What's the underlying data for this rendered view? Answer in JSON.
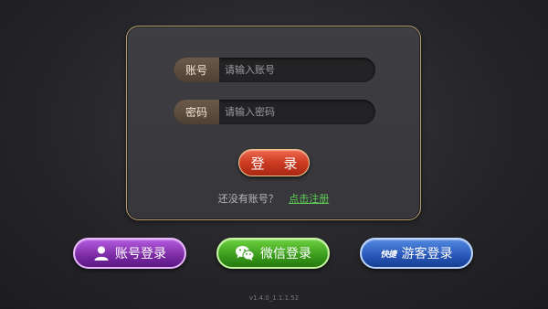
{
  "login_panel": {
    "account_field": {
      "label": "账号",
      "placeholder": "请输入账号",
      "value": ""
    },
    "password_field": {
      "label": "密码",
      "placeholder": "请输入密码",
      "value": ""
    },
    "login_button": "登 录",
    "register_prompt": "还没有账号？",
    "register_link": "点击注册"
  },
  "bottom_buttons": {
    "account_login": {
      "label": "账号登录",
      "icon": "user-icon",
      "color": "#7a2aa3"
    },
    "wechat_login": {
      "label": "微信登录",
      "icon": "wechat-icon",
      "color": "#3a9a1c"
    },
    "guest_login": {
      "label": "游客登录",
      "icon": "quick-icon",
      "icon_text": "快捷",
      "color": "#2856b8"
    }
  },
  "version": "v1.4.0_1.1.1.52",
  "colors": {
    "panel_border": "#b59a6e",
    "accent_link": "#5fcc56",
    "login_red": "#cc3b22"
  }
}
